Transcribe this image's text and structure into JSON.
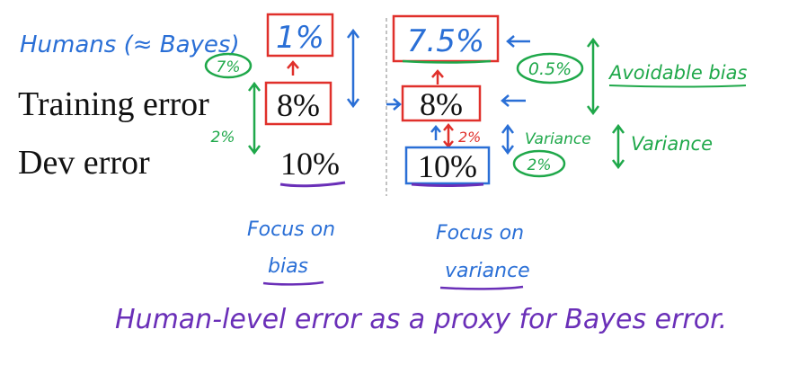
{
  "rows": {
    "humans": {
      "label": "Humans (≈ Bayes)",
      "left_value": "1%",
      "right_value": "7.5%"
    },
    "training": {
      "label": "Training error",
      "left_value": "8%",
      "right_value": "8%"
    },
    "dev": {
      "label": "Dev error",
      "left_value": "10%",
      "right_value": "10%"
    }
  },
  "annotations": {
    "left_gap_top": "7%",
    "left_gap_bottom": "2%",
    "right_gap_top": "0.5%",
    "right_gap_bottom": "2%",
    "right_gap_bottom_inner": "2%",
    "avoidable_bias": "Avoidable bias",
    "variance_small": "Variance",
    "variance_large": "Variance"
  },
  "focus": {
    "left_line1": "Focus on",
    "left_line2": "bias",
    "right_line1": "Focus on",
    "right_line2": "variance"
  },
  "footer": "Human-level error as a proxy for Bayes error."
}
